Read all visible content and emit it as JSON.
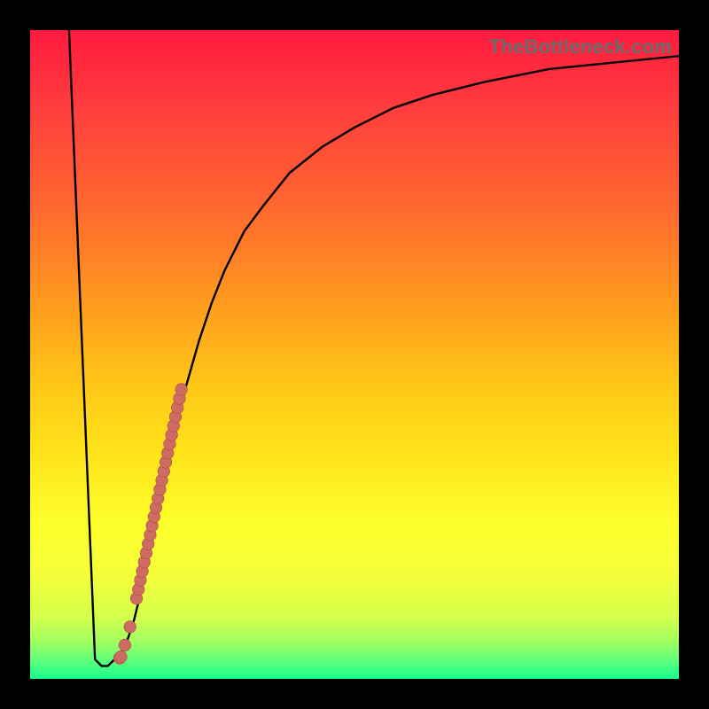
{
  "watermark": "TheBottleneck.com",
  "colors": {
    "background": "#000000",
    "curve": "#000000",
    "point": "#ce6b63",
    "point_stroke": "#a85048"
  },
  "chart_data": {
    "type": "line",
    "title": "",
    "xlabel": "",
    "ylabel": "",
    "xlim": [
      0,
      100
    ],
    "ylim": [
      0,
      100
    ],
    "series": [
      {
        "name": "curve",
        "x": [
          6,
          10,
          11,
          12,
          13,
          14,
          15,
          16,
          17,
          18,
          19,
          20,
          22,
          24,
          26,
          28,
          30,
          33,
          36,
          40,
          45,
          50,
          56,
          62,
          70,
          80,
          90,
          100
        ],
        "y": [
          100,
          3,
          2,
          2,
          3,
          4,
          6,
          9,
          13,
          18,
          23,
          28,
          37,
          45,
          52,
          58,
          63,
          69,
          73,
          78,
          82,
          85,
          88,
          90,
          92,
          94,
          95,
          96
        ]
      }
    ],
    "points_series": {
      "name": "highlighted-points",
      "x": [
        13.8,
        14.0,
        14.6,
        15.4,
        16.4,
        16.7,
        17.0,
        17.3,
        17.6,
        17.9,
        18.2,
        18.5,
        18.8,
        19.1,
        19.4,
        19.7,
        20.0,
        20.3,
        20.6,
        20.9,
        21.2,
        21.5,
        21.8,
        22.1,
        22.4,
        22.7,
        23.0,
        23.3
      ],
      "y": [
        3.2,
        3.4,
        5.2,
        8.0,
        12.4,
        13.8,
        15.2,
        16.6,
        18.0,
        19.4,
        20.8,
        22.2,
        23.6,
        25.0,
        26.4,
        27.8,
        29.2,
        30.6,
        32.0,
        33.4,
        34.8,
        36.2,
        37.6,
        39.0,
        40.4,
        41.8,
        43.2,
        44.6
      ]
    }
  }
}
